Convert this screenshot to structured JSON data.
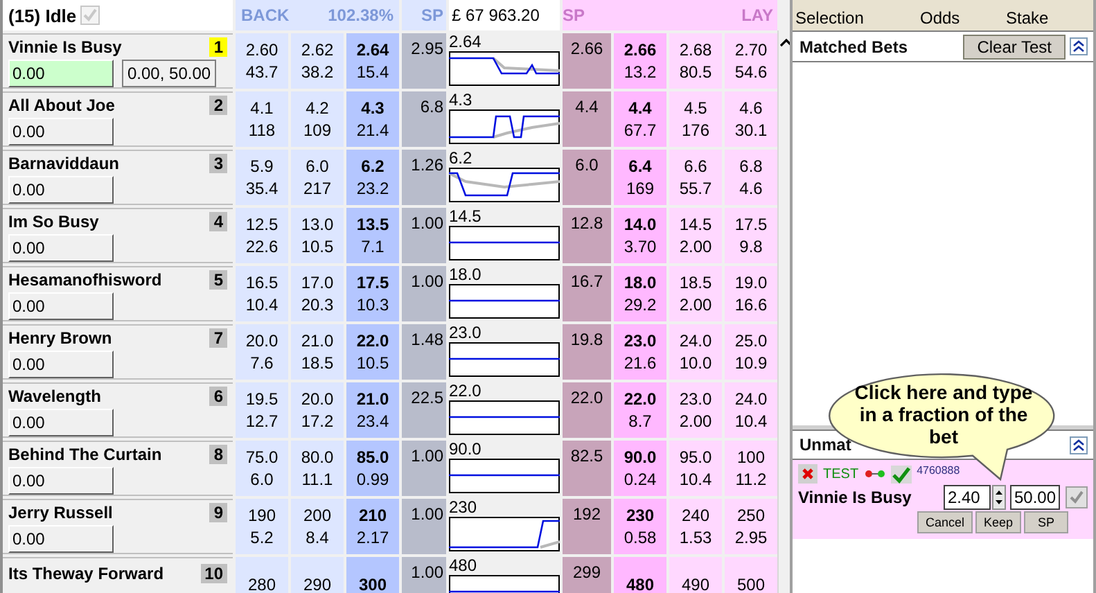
{
  "market": {
    "title": "(15) Idle",
    "idle_checked": true
  },
  "header": {
    "back_label": "BACK",
    "book_percent": "102.38%",
    "sp_back_label": "SP",
    "matched_total": "£ 67 963.20",
    "sp_lay_label": "SP",
    "lay_label": "LAY"
  },
  "runners": [
    {
      "name": "Vinnie Is Busy",
      "number": "1",
      "selected": true,
      "stake": "0.00",
      "stake_button": "0.00, 50.00",
      "back": [
        {
          "price": "2.60",
          "size": "43.7"
        },
        {
          "price": "2.62",
          "size": "38.2"
        },
        {
          "price": "2.64",
          "size": "15.4"
        }
      ],
      "sp_back": "2.95",
      "last_price": "2.64",
      "sp_lay": "2.66",
      "lay": [
        {
          "price": "2.66",
          "size": "13.2"
        },
        {
          "price": "2.68",
          "size": "80.5"
        },
        {
          "price": "2.70",
          "size": "54.6"
        }
      ]
    },
    {
      "name": "All About Joe",
      "number": "2",
      "selected": false,
      "stake": "0.00",
      "back": [
        {
          "price": "4.1",
          "size": "118"
        },
        {
          "price": "4.2",
          "size": "109"
        },
        {
          "price": "4.3",
          "size": "21.4"
        }
      ],
      "sp_back": "6.8",
      "last_price": "4.3",
      "sp_lay": "4.4",
      "lay": [
        {
          "price": "4.4",
          "size": "67.7"
        },
        {
          "price": "4.5",
          "size": "176"
        },
        {
          "price": "4.6",
          "size": "30.1"
        }
      ]
    },
    {
      "name": "Barnaviddaun",
      "number": "3",
      "selected": false,
      "stake": "0.00",
      "back": [
        {
          "price": "5.9",
          "size": "35.4"
        },
        {
          "price": "6.0",
          "size": "217"
        },
        {
          "price": "6.2",
          "size": "23.2"
        }
      ],
      "sp_back": "1.26",
      "last_price": "6.2",
      "sp_lay": "6.0",
      "lay": [
        {
          "price": "6.4",
          "size": "169"
        },
        {
          "price": "6.6",
          "size": "55.7"
        },
        {
          "price": "6.8",
          "size": "4.6"
        }
      ]
    },
    {
      "name": "Im So Busy",
      "number": "4",
      "selected": false,
      "stake": "0.00",
      "back": [
        {
          "price": "12.5",
          "size": "22.6"
        },
        {
          "price": "13.0",
          "size": "10.5"
        },
        {
          "price": "13.5",
          "size": "7.1"
        }
      ],
      "sp_back": "1.00",
      "last_price": "14.5",
      "sp_lay": "12.8",
      "lay": [
        {
          "price": "14.0",
          "size": "3.70"
        },
        {
          "price": "14.5",
          "size": "2.00"
        },
        {
          "price": "17.5",
          "size": "9.8"
        }
      ]
    },
    {
      "name": "Hesamanofhisword",
      "number": "5",
      "selected": false,
      "stake": "0.00",
      "back": [
        {
          "price": "16.5",
          "size": "10.4"
        },
        {
          "price": "17.0",
          "size": "20.3"
        },
        {
          "price": "17.5",
          "size": "10.3"
        }
      ],
      "sp_back": "1.00",
      "last_price": "18.0",
      "sp_lay": "16.7",
      "lay": [
        {
          "price": "18.0",
          "size": "29.2"
        },
        {
          "price": "18.5",
          "size": "2.00"
        },
        {
          "price": "19.0",
          "size": "16.6"
        }
      ]
    },
    {
      "name": "Henry Brown",
      "number": "7",
      "selected": false,
      "stake": "0.00",
      "back": [
        {
          "price": "20.0",
          "size": "7.6"
        },
        {
          "price": "21.0",
          "size": "18.5"
        },
        {
          "price": "22.0",
          "size": "10.5"
        }
      ],
      "sp_back": "1.48",
      "last_price": "23.0",
      "sp_lay": "19.8",
      "lay": [
        {
          "price": "23.0",
          "size": "21.6"
        },
        {
          "price": "24.0",
          "size": "10.0"
        },
        {
          "price": "25.0",
          "size": "10.9"
        }
      ]
    },
    {
      "name": "Wavelength",
      "number": "6",
      "selected": false,
      "stake": "0.00",
      "back": [
        {
          "price": "19.5",
          "size": "12.7"
        },
        {
          "price": "20.0",
          "size": "17.2"
        },
        {
          "price": "21.0",
          "size": "23.4"
        }
      ],
      "sp_back": "22.5",
      "last_price": "22.0",
      "sp_lay": "22.0",
      "lay": [
        {
          "price": "22.0",
          "size": "8.7"
        },
        {
          "price": "23.0",
          "size": "2.00"
        },
        {
          "price": "24.0",
          "size": "10.4"
        }
      ]
    },
    {
      "name": "Behind The Curtain",
      "number": "8",
      "selected": false,
      "stake": "0.00",
      "back": [
        {
          "price": "75.0",
          "size": "6.0"
        },
        {
          "price": "80.0",
          "size": "11.1"
        },
        {
          "price": "85.0",
          "size": "0.99"
        }
      ],
      "sp_back": "1.00",
      "last_price": "90.0",
      "sp_lay": "82.5",
      "lay": [
        {
          "price": "90.0",
          "size": "0.24"
        },
        {
          "price": "95.0",
          "size": "10.4"
        },
        {
          "price": "100",
          "size": "11.2"
        }
      ]
    },
    {
      "name": "Jerry Russell",
      "number": "9",
      "selected": false,
      "stake": "0.00",
      "back": [
        {
          "price": "190",
          "size": "5.2"
        },
        {
          "price": "200",
          "size": "8.4"
        },
        {
          "price": "210",
          "size": "2.17"
        }
      ],
      "sp_back": "1.00",
      "last_price": "230",
      "sp_lay": "192",
      "lay": [
        {
          "price": "230",
          "size": "0.58"
        },
        {
          "price": "240",
          "size": "1.53"
        },
        {
          "price": "250",
          "size": "2.95"
        }
      ]
    },
    {
      "name": "Its Theway Forward",
      "number": "10",
      "selected": false,
      "back": [
        {
          "price": "280"
        },
        {
          "price": "290"
        },
        {
          "price": "300"
        }
      ],
      "sp_back": "1.00",
      "last_price": "480",
      "sp_lay": "299",
      "lay": [
        {
          "price": "480"
        },
        {
          "price": "490"
        },
        {
          "price": "500"
        }
      ]
    }
  ],
  "bet_panel": {
    "columns": [
      "Selection",
      "Odds",
      "Stake"
    ],
    "matched": {
      "title": "Matched Bets",
      "clear_button": "Clear Test"
    },
    "unmatched": {
      "title": "Unmat",
      "bets": [
        {
          "mode": "TEST",
          "ref": "4760888",
          "runner": "Vinnie Is Busy",
          "odds": "2.40",
          "stake": "50.00",
          "actions": [
            "Cancel",
            "Keep",
            "SP"
          ]
        }
      ]
    }
  },
  "callout": {
    "text": "Click here and type in a fraction of the bet"
  }
}
